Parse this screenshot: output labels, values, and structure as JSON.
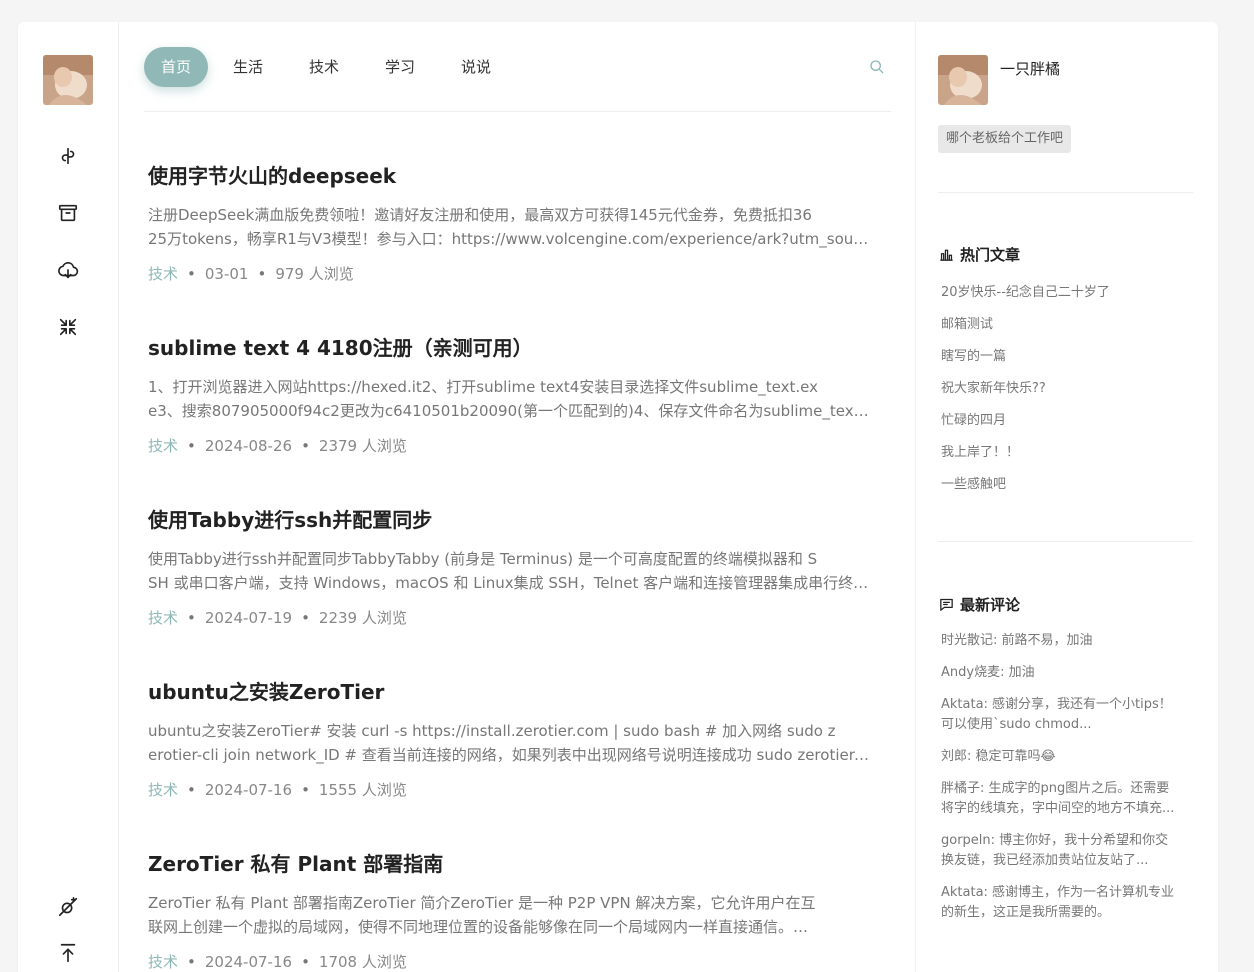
{
  "nav": {
    "tabs": [
      {
        "label": "首页",
        "active": true
      },
      {
        "label": "生活"
      },
      {
        "label": "技术"
      },
      {
        "label": "学习"
      },
      {
        "label": "说说"
      }
    ]
  },
  "rail": {
    "icons": [
      "link-icon",
      "archive-icon",
      "cloud-icon",
      "shrink-icon",
      "theme-toggle-icon",
      "back-to-top-icon"
    ]
  },
  "posts": [
    {
      "title": "使用字节火山的deepseek",
      "excerpt_line1": "注册DeepSeek满血版免费领啦！邀请好友注册和使用，最高双方可获得145元代金券，免费抵扣36",
      "excerpt_line2": "25万tokens，畅享R1与V3模型！参与入口：https://www.volcengine.com/experience/ark?utm_source=…",
      "category": "技术",
      "date": "03-01",
      "views": "979 人浏览"
    },
    {
      "title": "sublime text 4 4180注册（亲测可用）",
      "excerpt_line1": "1、打开浏览器进入网站https://hexed.it2、打开sublime text4安装目录选择文件sublime_text.ex",
      "excerpt_line2": "e3、搜索807905000f94c2更改为c6410501b20090(第一个匹配到的)4、保存文件命名为sublime_text.exe…",
      "category": "技术",
      "date": "2024-08-26",
      "views": "2379 人浏览"
    },
    {
      "title": "使用Tabby进行ssh并配置同步",
      "excerpt_line1": "使用Tabby进行ssh并配置同步TabbyTabby (前身是 Terminus) 是一个可高度配置的终端模拟器和 S",
      "excerpt_line2": "SH 或串口客户端，支持 Windows，macOS 和 Linux集成 SSH，Telnet 客户端和连接管理器集成串行终端…",
      "category": "技术",
      "date": "2024-07-19",
      "views": "2239 人浏览"
    },
    {
      "title": "ubuntu之安装ZeroTier",
      "excerpt_line1": "ubuntu之安装ZeroTier# 安装 curl -s https://install.zerotier.com | sudo bash # 加入网络 sudo z",
      "excerpt_line2": "erotier-cli join network_ID # 查看当前连接的网络，如果列表中出现网络号说明连接成功 sudo zerotier-cli…",
      "category": "技术",
      "date": "2024-07-16",
      "views": "1555 人浏览"
    },
    {
      "title": "ZeroTier 私有 Plant 部署指南",
      "excerpt_line1": "ZeroTier 私有 Plant 部署指南ZeroTier 简介ZeroTier 是一种 P2P VPN 解决方案，它允许用户在互",
      "excerpt_line2": "联网上创建一个虚拟的局域网，使得不同地理位置的设备能够像在同一个局域网内一样直接通信。…",
      "category": "技术",
      "date": "2024-07-16",
      "views": "1708 人浏览"
    }
  ],
  "sidebar": {
    "name": "一只胖橘",
    "tag": "哪个老板给个工作吧",
    "hot_title": "热门文章",
    "hot_posts": [
      "20岁快乐--纪念自己二十岁了",
      "邮箱测试",
      "瞎写的一篇",
      "祝大家新年快乐??",
      "忙碌的四月",
      "我上岸了！！",
      "一些感触吧"
    ],
    "comments_title": "最新评论",
    "comments": [
      {
        "line1": "时光散记: 前路不易，加油",
        "line2": ""
      },
      {
        "line1": "Andy烧麦: 加油",
        "line2": ""
      },
      {
        "line1": "Aktata: 感谢分享，我还有一个小tips！",
        "line2": "可以使用`sudo chmod..."
      },
      {
        "line1": "刘郎: 稳定可靠吗😂",
        "line2": ""
      },
      {
        "line1": "胖橘子: 生成字的png图片之后。还需要",
        "line2": "将字的线填充，字中间空的地方不填充..."
      },
      {
        "line1": "gorpeln: 博主你好，我十分希望和你交",
        "line2": "换友链，我已经添加贵站位友站了..."
      },
      {
        "line1": "Aktata: 感谢博主，作为一名计算机专业",
        "line2": "的新生，这正是我所需要的。"
      }
    ]
  },
  "colors": {
    "accent": "#8fb8b6",
    "background": "#f5f5f5",
    "text": "#333333",
    "muted": "#777777"
  }
}
